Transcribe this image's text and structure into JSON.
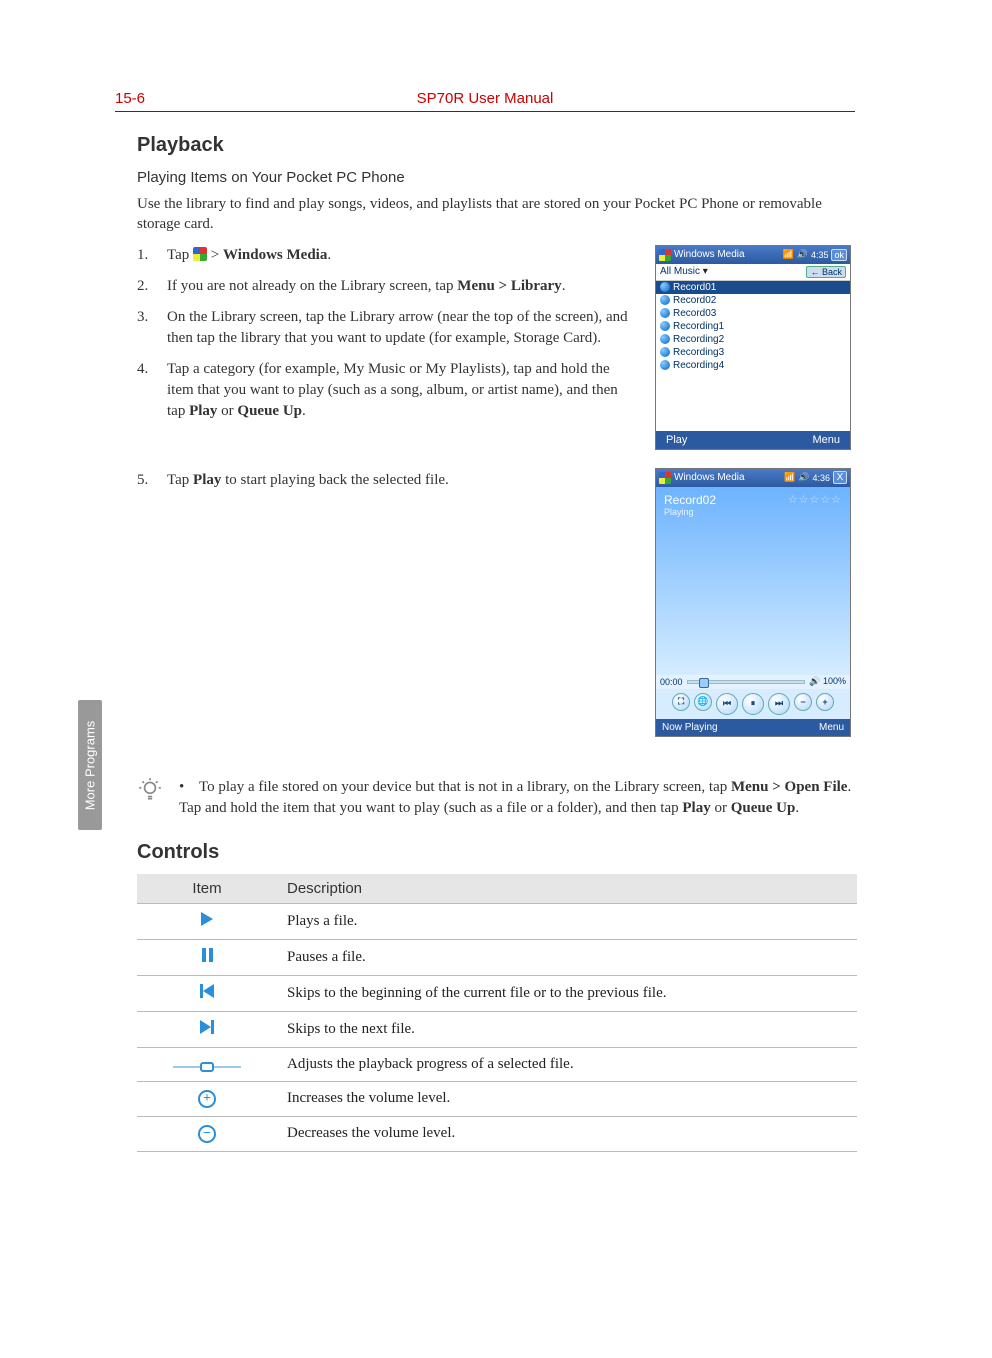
{
  "header": {
    "page": "15-6",
    "title": "SP70R User Manual"
  },
  "side_tab": "More Programs",
  "section1": {
    "heading": "Playback",
    "subheading": "Playing Items on Your Pocket PC Phone",
    "intro": "Use the library to find and play songs, videos, and playlists that are stored on your Pocket PC Phone or removable storage card.",
    "steps": {
      "s1a": "Tap ",
      "s1b": " > ",
      "s1c": "Windows Media",
      "s1d": ".",
      "s2a": "If you are not already on the Library screen, tap ",
      "s2b": "Menu > Library",
      "s2c": ".",
      "s3": "On the Library screen, tap the Library arrow (near the top of the screen), and then tap the library that you want to update (for example, Storage Card).",
      "s4a": "Tap a category (for example, My Music or My Playlists), tap and hold the item that you want to play (such as a song, album, or artist name), and then tap ",
      "s4b": "Play",
      "s4c": " or ",
      "s4d": "Queue Up",
      "s4e": ".",
      "s5a": "Tap ",
      "s5b": "Play",
      "s5c": " to start playing back the selected file."
    }
  },
  "screenshot1": {
    "title": "Windows Media",
    "ok": "ok",
    "time": "4:35",
    "header": "All Music",
    "back": "Back",
    "items": [
      "Record01",
      "Record02",
      "Record03",
      "Recording1",
      "Recording2",
      "Recording3",
      "Recording4"
    ],
    "footer_left": "Play",
    "footer_right": "Menu"
  },
  "screenshot2": {
    "title": "Windows Media",
    "time": "4:36",
    "close": "X",
    "song": "Record02",
    "status": "Playing",
    "stars": "☆☆☆☆☆",
    "time_elapsed": "00:00",
    "vol": "100%",
    "footer_left": "Now Playing",
    "footer_right": "Menu"
  },
  "tip": {
    "bullet": "•",
    "a": "To play a file stored on your device but that is not in a library, on the Library screen, tap ",
    "b": "Menu > Open File",
    "c": ". Tap and hold the item that you want to play (such as a file or a folder), and then tap ",
    "d": "Play",
    "e": " or ",
    "f": "Queue Up",
    "g": "."
  },
  "controls": {
    "heading": "Controls",
    "th_item": "Item",
    "th_desc": "Description",
    "rows": [
      {
        "icon": "play",
        "desc": "Plays a file."
      },
      {
        "icon": "pause",
        "desc": "Pauses a file."
      },
      {
        "icon": "prev",
        "desc": "Skips to the beginning of the current file or to the previous file."
      },
      {
        "icon": "next",
        "desc": "Skips to the next file."
      },
      {
        "icon": "slider",
        "desc": "Adjusts the playback progress of a selected file."
      },
      {
        "icon": "volup",
        "desc": "Increases the volume level."
      },
      {
        "icon": "voldown",
        "desc": "Decreases the volume level."
      }
    ]
  }
}
